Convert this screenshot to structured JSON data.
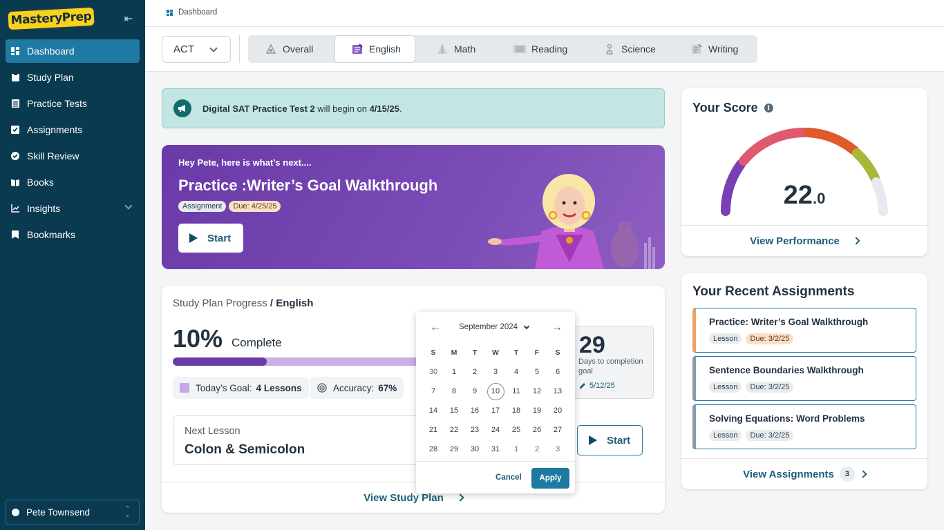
{
  "app": {
    "logo_text": "MasteryPrep"
  },
  "sidebar": {
    "items": [
      {
        "label": "Dashboard",
        "icon": "dashboard-icon"
      },
      {
        "label": "Study Plan",
        "icon": "clipboard-icon"
      },
      {
        "label": "Practice Tests",
        "icon": "list-icon"
      },
      {
        "label": "Assignments",
        "icon": "checkmark-square-icon"
      },
      {
        "label": "Skill Review",
        "icon": "check-circle-icon"
      },
      {
        "label": "Books",
        "icon": "book-icon"
      },
      {
        "label": "Insights",
        "icon": "chart-icon"
      },
      {
        "label": "Bookmarks",
        "icon": "bookmark-icon"
      }
    ],
    "user": "Pete Townsend"
  },
  "breadcrumb": "Dashboard",
  "exam_select": {
    "value": "ACT"
  },
  "subject_tabs": [
    {
      "label": "Overall",
      "icon": "overall-icon"
    },
    {
      "label": "English",
      "icon": "english-icon"
    },
    {
      "label": "Math",
      "icon": "math-icon"
    },
    {
      "label": "Reading",
      "icon": "reading-icon"
    },
    {
      "label": "Science",
      "icon": "science-icon"
    },
    {
      "label": "Writing",
      "icon": "writing-icon"
    }
  ],
  "announcement": {
    "test": "Digital SAT Practice Test 2",
    "middle": " will begin on ",
    "date": "4/15/25",
    "end": "."
  },
  "hero": {
    "greeting": "Hey Pete, here is what’s next....",
    "title": "Practice :Writer’s Goal Walkthrough",
    "type_badge": "Assignment",
    "due_badge": "Due: 4/25/25",
    "start_label": "Start"
  },
  "study_plan": {
    "title_prefix": "Study Plan Progress",
    "separator": " / ",
    "subject": "English",
    "percent_text": "10%",
    "percent_label": "Complete",
    "progress": 0.34,
    "today_goal_label": "Today’s Goal:",
    "today_goal_value": "4 Lessons",
    "accuracy_label": "Accuracy:",
    "accuracy_value": "67%",
    "next_lesson_label": "Next Lesson",
    "next_lesson_title": "Colon & Semicolon",
    "start_label": "Start",
    "days_number": "29",
    "days_label": "Days to completion goal",
    "goal_date": "5/12/25",
    "view_label": "View Study Plan"
  },
  "calendar": {
    "month": "September 2024",
    "weekdays": [
      "S",
      "M",
      "T",
      "W",
      "T",
      "F",
      "S"
    ],
    "weeks": [
      [
        "30",
        "1",
        "2",
        "3",
        "4",
        "5",
        "6"
      ],
      [
        "7",
        "8",
        "9",
        "10",
        "11",
        "12",
        "13"
      ],
      [
        "14",
        "15",
        "16",
        "17",
        "18",
        "19",
        "20"
      ],
      [
        "21",
        "22",
        "23",
        "24",
        "25",
        "26",
        "27"
      ],
      [
        "28",
        "29",
        "30",
        "31",
        "1",
        "2",
        "3"
      ]
    ],
    "selected": "10",
    "cancel_label": "Cancel",
    "apply_label": "Apply"
  },
  "score": {
    "title": "Your Score",
    "value_main": "22",
    "value_decimal": ".0",
    "view_label": "View Performance",
    "gauge_colors": [
      "#7a3fb4",
      "#e05a6e",
      "#e05a2a",
      "#a8b836",
      "#e6eaee"
    ]
  },
  "recent": {
    "title": "Your Recent Assignments",
    "items": [
      {
        "title": "Practice: Writer’s Goal Walkthrough",
        "type": "Lesson",
        "due": "Due: 3/2/25"
      },
      {
        "title": "Sentence Boundaries Walkthrough",
        "type": "Lesson",
        "due": "Due: 3/2/25"
      },
      {
        "title": "Solving Equations: Word Problems",
        "type": "Lesson",
        "due": "Due: 3/2/25"
      }
    ],
    "view_label": "View Assignments",
    "count": "3"
  }
}
